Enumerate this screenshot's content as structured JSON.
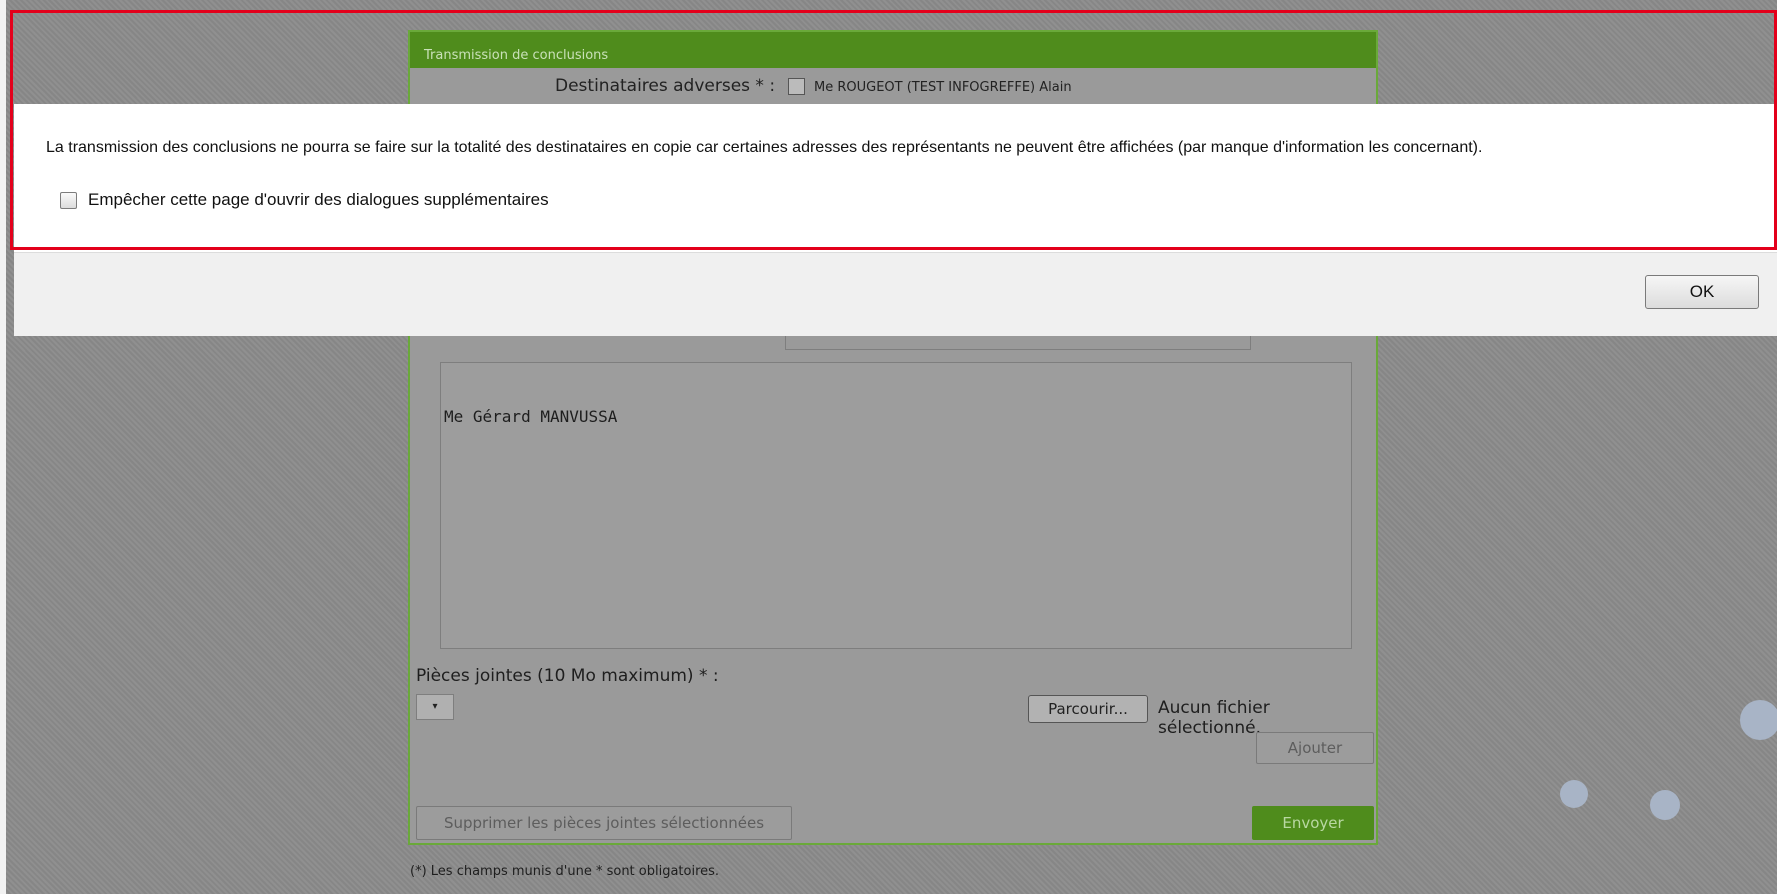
{
  "form": {
    "header_title": "Transmission de conclusions",
    "recipients_label": "Destinataires adverses * :",
    "recipient_name": "Me ROUGEOT (TEST INFOGREFFE) Alain",
    "body_text": "Me Gérard MANVUSSA",
    "attachments_label": "Pièces jointes (10 Mo maximum) * :",
    "select_value": "▾",
    "browse_label": "Parcourir...",
    "no_file_text": "Aucun fichier sélectionné.",
    "add_label": "Ajouter",
    "delete_label": "Supprimer les pièces jointes sélectionnées",
    "send_label": "Envoyer",
    "required_note": "(*) Les champs munis d'une * sont obligatoires."
  },
  "dialog": {
    "message": "La transmission des conclusions ne pourra se faire sur la totalité des destinataires en copie car certaines adresses des représentants ne peuvent être affichées (par manque d'information les concernant).",
    "suppress_label": "Empêcher cette page d'ouvrir des dialogues supplémentaires",
    "suppress_checked": false,
    "ok_label": "OK"
  },
  "colors": {
    "form_green": "#4f8c1c",
    "highlight_red": "#e3001b"
  }
}
